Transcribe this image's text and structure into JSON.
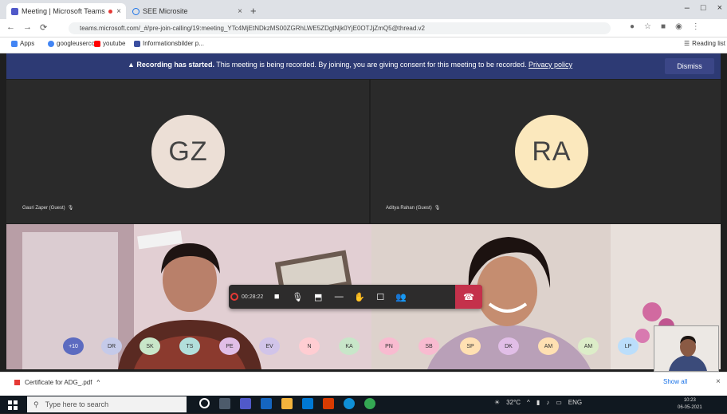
{
  "browser": {
    "tabs": [
      {
        "title": "Meeting | Microsoft Teams",
        "close": "×"
      },
      {
        "title": "SEE Microsite",
        "close": "×"
      }
    ],
    "new_tab": "+",
    "window_controls": [
      "–",
      "□",
      "×"
    ],
    "nav": [
      "←",
      "→",
      "⟳"
    ],
    "url": "teams.microsoft.com/_#/pre-join-calling/19:meeting_YTc4MjEtNDkzMS00ZGRhLWE5ZDgtNjk0YjE0OTJjZmQ5@thread.v2",
    "bookmarks": [
      {
        "label": "Apps",
        "color": "#4285f4"
      },
      {
        "label": "googleusercon",
        "color": "#4285f4"
      },
      {
        "label": "youtube",
        "color": "#ff0000"
      },
      {
        "label": "Informationsbilder p...",
        "color": "#3b4fa0"
      }
    ],
    "reading_list": "Reading list"
  },
  "banner": {
    "bold": "Recording has started.",
    "text": " This meeting is being recorded. By joining, you are giving consent for this meeting to be recorded.",
    "link": "Privacy policy",
    "dismiss": "Dismiss"
  },
  "participants": {
    "left": {
      "initials": "GZ",
      "name": "Gauri Zaper (Guest)",
      "mic": "🎙"
    },
    "right": {
      "initials": "RA",
      "name": "Aditya Rahan (Guest)",
      "mic": "🎙"
    }
  },
  "toolbar": {
    "timer": "00:28:22"
  },
  "chips": [
    {
      "text": "+10",
      "bg": "#5c6bc0",
      "fg": "#fff"
    },
    {
      "text": "DR",
      "bg": "#c5cae9",
      "fg": "#333"
    },
    {
      "text": "SK",
      "bg": "#c8e6c9",
      "fg": "#333"
    },
    {
      "text": "TS",
      "bg": "#b2dfdb",
      "fg": "#333"
    },
    {
      "text": "PE",
      "bg": "#e1bee7",
      "fg": "#333"
    },
    {
      "text": "EV",
      "bg": "#d1c4e9",
      "fg": "#333"
    },
    {
      "text": "N",
      "bg": "#ffcdd2",
      "fg": "#333"
    },
    {
      "text": "KA",
      "bg": "#c8e6c9",
      "fg": "#333"
    },
    {
      "text": "PN",
      "bg": "#f8bbd0",
      "fg": "#333"
    },
    {
      "text": "SB",
      "bg": "#f8bbd0",
      "fg": "#333"
    },
    {
      "text": "SP",
      "bg": "#ffe0b2",
      "fg": "#333"
    },
    {
      "text": "DK",
      "bg": "#e1bee7",
      "fg": "#333"
    },
    {
      "text": "AM",
      "bg": "#ffe0b2",
      "fg": "#333"
    },
    {
      "text": "AM",
      "bg": "#dcedc8",
      "fg": "#333"
    },
    {
      "text": "LP",
      "bg": "#bbdefb",
      "fg": "#333"
    }
  ],
  "download": {
    "file": "Certificate for ADG_.pdf",
    "caret": "^",
    "show_all": "Show all",
    "close": "×"
  },
  "taskbar": {
    "search_placeholder": "Type here to search",
    "tray_temp": "32°C",
    "tray_lang": "ENG",
    "time": "10:23",
    "date": "06-05-2021"
  }
}
